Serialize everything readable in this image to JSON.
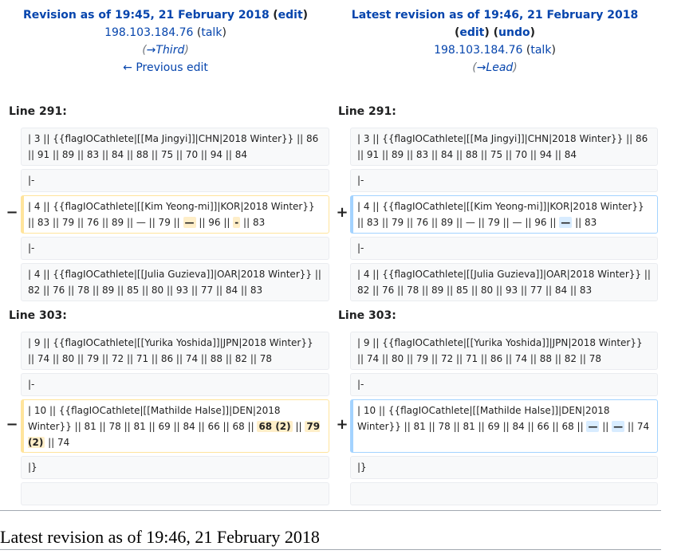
{
  "left_header": {
    "title": "Revision as of 19:45, 21 February 2018",
    "edit_label": "edit",
    "user": "198.103.184.76",
    "talk_label": "talk",
    "section": "→Third",
    "prev_edit": "← Previous edit"
  },
  "right_header": {
    "title": "Latest revision as of 19:46, 21 February 2018",
    "edit_label": "edit",
    "undo_label": "undo",
    "user": "198.103.184.76",
    "talk_label": "talk",
    "section": "→Lead"
  },
  "block1": {
    "left_line": "Line 291:",
    "right_line": "Line 291:",
    "ctx_a": "| 3 || {{flagIOCathlete|[[Ma Jingyi]]|CHN|2018 Winter}} || 86 || 91 || 89 || 83 || 84 || 88 || 75 || 70 || 94 || 84",
    "ctx_b": "|-",
    "del_prefix": "| 4 || {{flagIOCathlete|[[Kim Yeong-mi]]|KOR|2018 Winter}} || 83 || 79 || 76 || 89 || — || 79 || ",
    "del_hl1": "—",
    "del_mid": " || 96 || ",
    "del_hl2": "-",
    "del_suffix": " || 83",
    "add_prefix": "| 4 || {{flagIOCathlete|[[Kim Yeong-mi]]|KOR|2018 Winter}} || 83 || 79 || 76 || 89 || — || 79 || — || 96 || ",
    "add_hl": "—",
    "add_suffix": " || 83",
    "ctx_c": "|-",
    "ctx_d": "| 4 || {{flagIOCathlete|[[Julia Guzieva]]|OAR|2018 Winter}} || 82 || 76 || 78 || 89 || 85 || 80 || 93 || 77 || 84 || 83"
  },
  "block2": {
    "left_line": "Line 303:",
    "right_line": "Line 303:",
    "ctx_a": "| 9 || {{flagIOCathlete|[[Yurika Yoshida]]|JPN|2018 Winter}} || 74 || 80 || 79 || 72 || 71 || 86 || 74 || 88 || 82 || 78",
    "ctx_b": "|-",
    "del_prefix": "| 10 || {{flagIOCathlete|[[Mathilde Halse]]|DEN|2018 Winter}} || 81 || 78 || 81 || 69 || 84 || 66 || 68 || ",
    "del_hl1": "68 (2)",
    "del_mid": " || ",
    "del_hl2": "79 (2)",
    "del_suffix": " || 74",
    "add_prefix": "| 10 || {{flagIOCathlete|[[Mathilde Halse]]|DEN|2018 Winter}} || 81 || 78 || 81 || 69 || 84 || 66 || 68 || ",
    "add_hl1": "—",
    "add_mid": " || ",
    "add_hl2": "—",
    "add_suffix": " || 74",
    "ctx_c": "|}",
    "ctx_d": ""
  },
  "markers": {
    "minus": "−",
    "plus": "+"
  },
  "page_heading": "Latest revision as of 19:46, 21 February 2018",
  "colors": {
    "link": "#0645ad",
    "del_border": "#ffe49c",
    "add_border": "#a3d3ff",
    "del_hl": "#feeec8",
    "add_hl": "#d8ecff"
  }
}
